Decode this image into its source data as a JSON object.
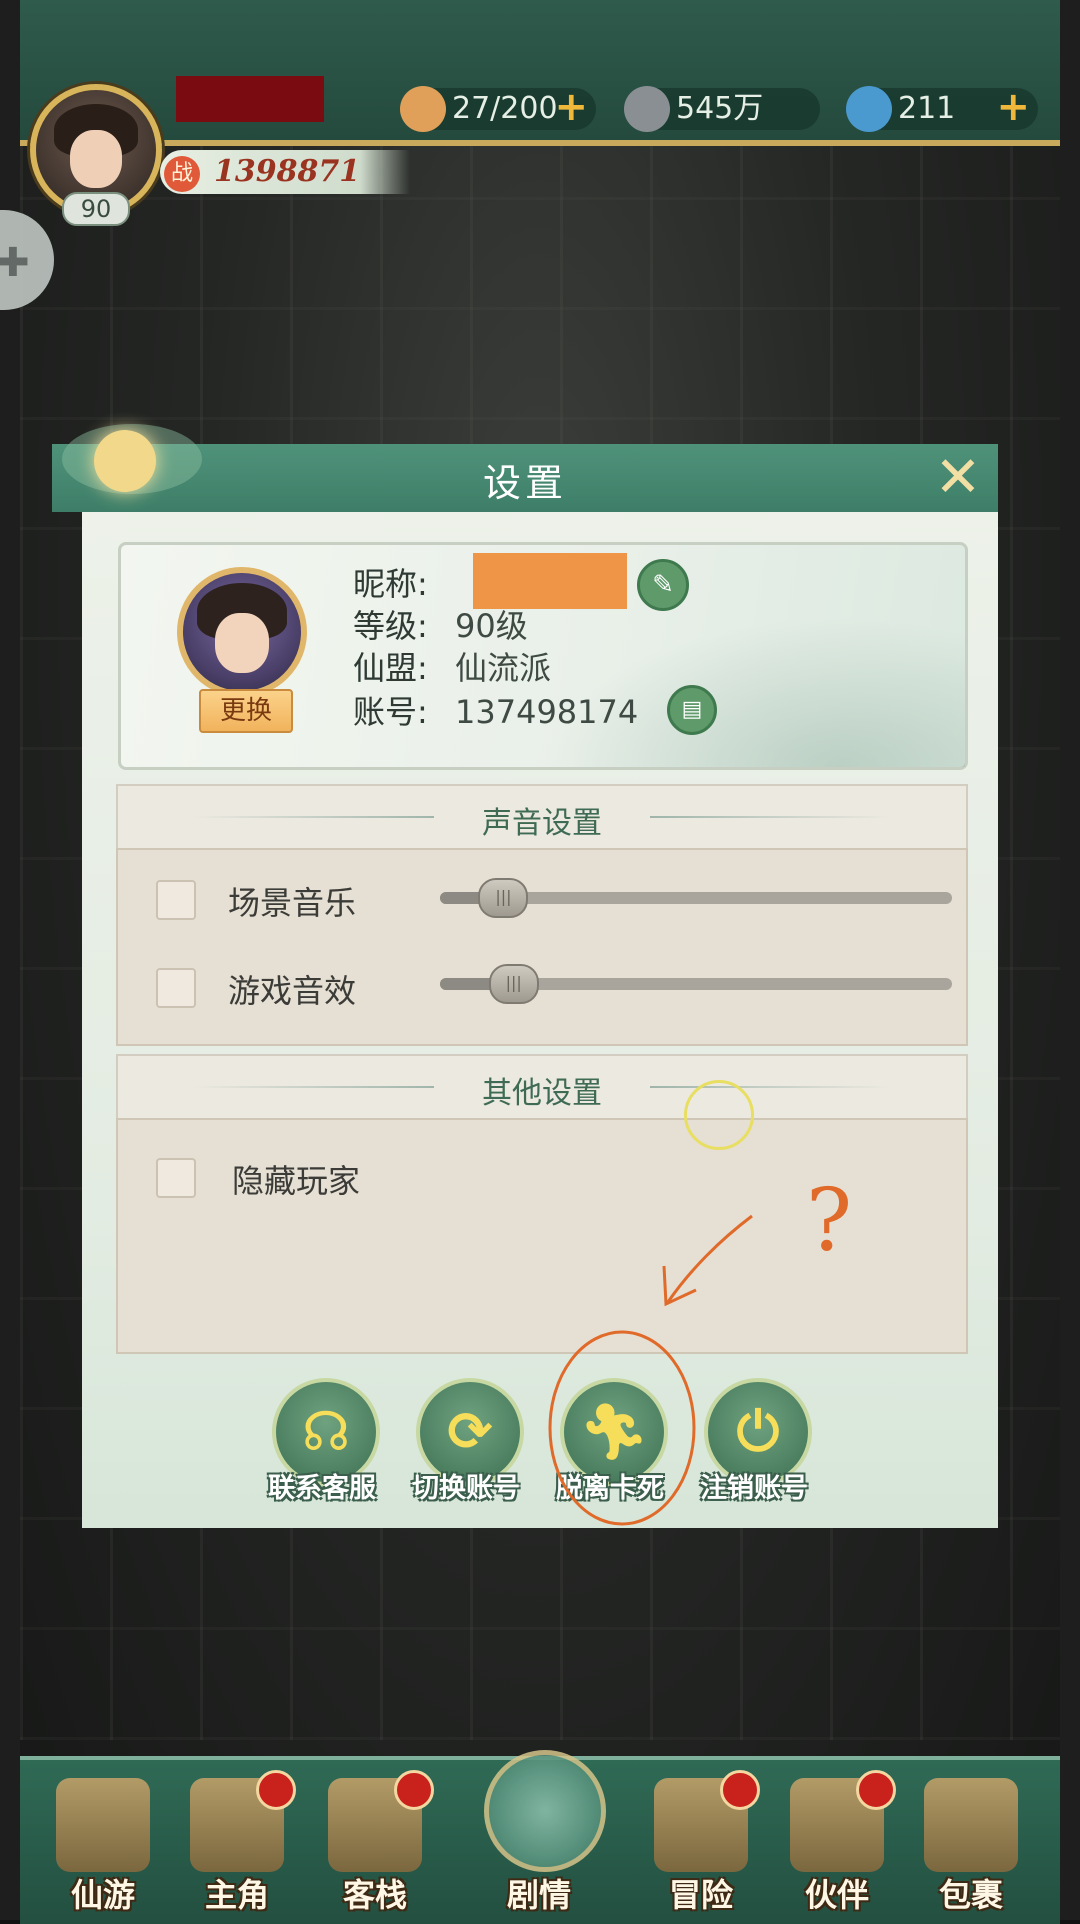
{
  "topbar": {
    "player_level": "90",
    "power_icon": "战",
    "power": "1398871",
    "resources": [
      {
        "icon": "bun-icon",
        "value": "27/200",
        "color": "#e0a05a"
      },
      {
        "icon": "coin-icon",
        "value": "545万",
        "color": "#8a8f93"
      },
      {
        "icon": "jade-icon",
        "value": "211",
        "color": "#4a9ad0"
      }
    ]
  },
  "dialog": {
    "title": "设置",
    "close": "✕",
    "profile": {
      "change_label": "更换",
      "nickname_label": "昵称:",
      "level_label": "等级:",
      "level_value": "90级",
      "guild_label": "仙盟:",
      "guild_value": "仙流派",
      "account_label": "账号:",
      "account_value": "137498174"
    },
    "sound_section": {
      "title": "声音设置",
      "items": [
        {
          "label": "场景音乐",
          "checked": false,
          "volume": 0.12
        },
        {
          "label": "游戏音效",
          "checked": false,
          "volume": 0.14
        }
      ]
    },
    "other_section": {
      "title": "其他设置",
      "items": [
        {
          "label": "隐藏玩家",
          "checked": false
        }
      ]
    },
    "actions": [
      {
        "label": "联系客服",
        "icon": "headset-icon"
      },
      {
        "label": "切换账号",
        "icon": "refresh-icon"
      },
      {
        "label": "脱离卡死",
        "icon": "running-man-icon"
      },
      {
        "label": "注销账号",
        "icon": "power-icon"
      }
    ]
  },
  "annotation": {
    "mark": "?"
  },
  "bottom_nav": [
    {
      "label": "仙游",
      "badge": false
    },
    {
      "label": "主角",
      "badge": true
    },
    {
      "label": "客栈",
      "badge": true
    },
    {
      "label": "剧情",
      "badge": false
    },
    {
      "label": "冒险",
      "badge": true
    },
    {
      "label": "伙伴",
      "badge": true
    },
    {
      "label": "包裹",
      "badge": false
    }
  ],
  "colors": {
    "accent_green": "#3e7e68",
    "gold": "#d8b45a",
    "annotation_orange": "#e06a2a"
  }
}
